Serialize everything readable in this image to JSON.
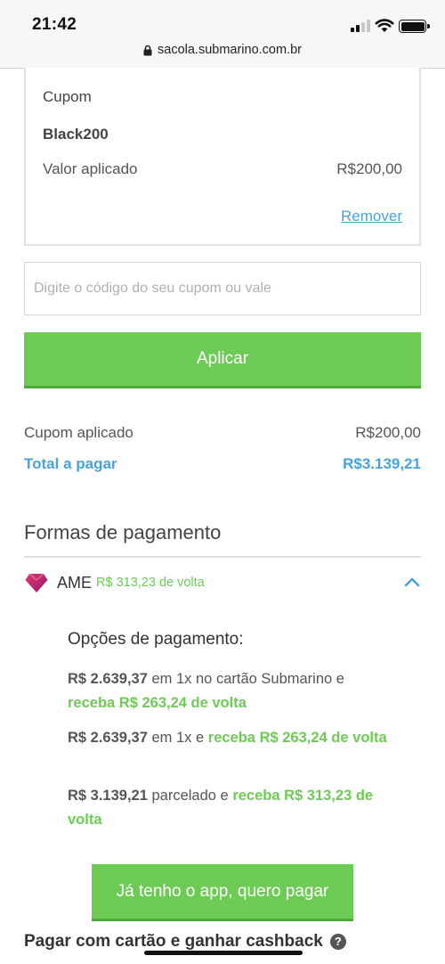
{
  "status_bar": {
    "time": "21:42"
  },
  "browser": {
    "url": "sacola.submarino.com.br",
    "lock_icon": "lock-icon"
  },
  "coupon_card": {
    "title": "Cupom",
    "code": "Black200",
    "applied_label": "Valor aplicado",
    "applied_value": "R$200,00",
    "remove_label": "Remover"
  },
  "coupon_input": {
    "placeholder": "Digite o código do seu cupom ou vale",
    "value": ""
  },
  "apply_button": {
    "label": "Aplicar"
  },
  "summary": {
    "coupon_label": "Cupom aplicado",
    "coupon_value": "R$200,00",
    "total_label": "Total a pagar",
    "total_value": "R$3.139,21"
  },
  "payment": {
    "heading": "Formas de pagamento",
    "ame": {
      "name": "AME",
      "cashback": "R$ 313,23 de volta",
      "logo_icon": "ame-heart-icon",
      "chevron_icon": "chevron-up-icon"
    },
    "options_heading": "Opções de pagamento:",
    "options": [
      {
        "amount": "R$ 2.639,37",
        "text": " em 1x no cartão Submarino e ",
        "cashback": "receba R$ 263,24 de volta"
      },
      {
        "amount": "R$ 2.639,37",
        "text": " em 1x e ",
        "cashback": "receba R$ 263,24 de volta"
      },
      {
        "amount": "R$ 3.139,21",
        "text": " parcelado e ",
        "cashback": "receba R$ 313,23 de volta"
      }
    ],
    "app_button_label": "Já tenho o app, quero pagar",
    "card_cashback_label": "Pagar com cartão e ganhar cashback",
    "help_icon": "question-circle-icon"
  },
  "colors": {
    "green": "#6dcb55",
    "blue": "#4aa3d8",
    "ame_pink": "#c4226a"
  }
}
